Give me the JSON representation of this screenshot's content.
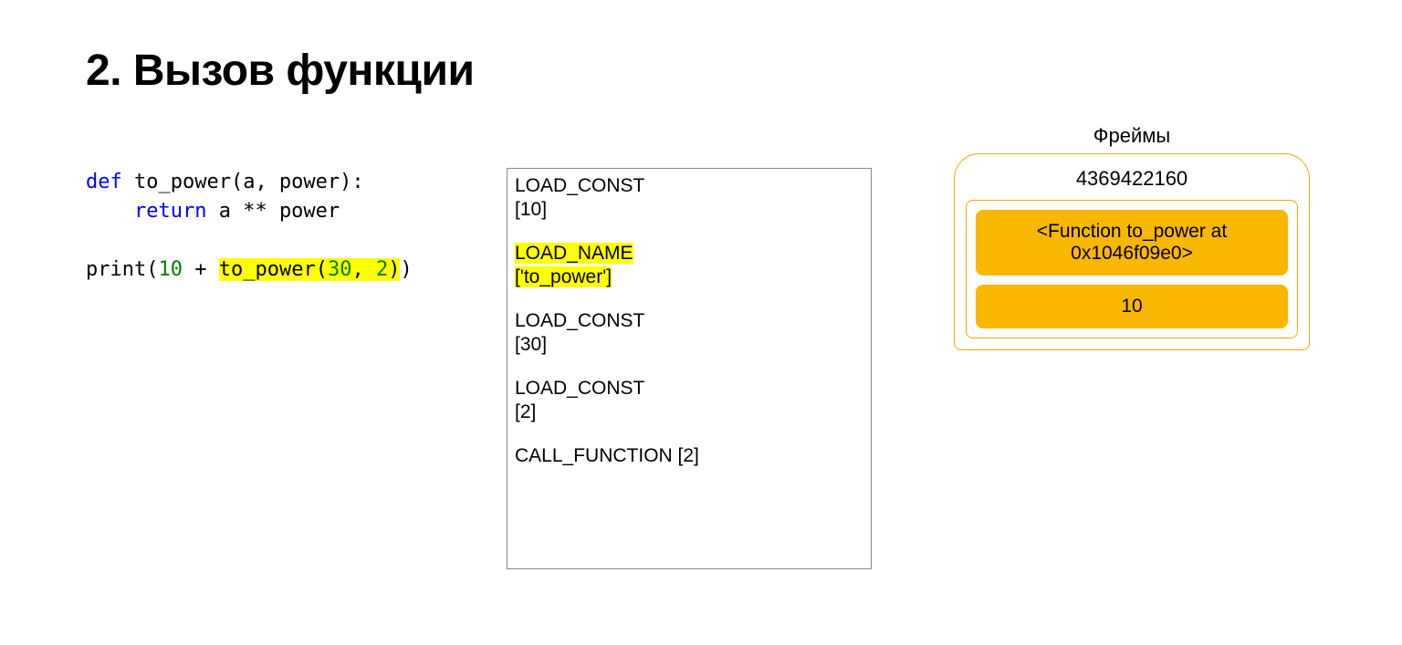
{
  "title": "2. Вызов функции",
  "code": {
    "line1": {
      "def": "def",
      "rest": " to_power(a, power):"
    },
    "line2": {
      "indent": "    ",
      "ret": "return",
      "mid": " a ** power"
    },
    "line3": {
      "pre": "print(",
      "num1": "10",
      "plus": " + ",
      "call_fn": "to_power(",
      "num2": "30",
      "comma": ", ",
      "num3": "2",
      "call_close": ")",
      "post": ")"
    }
  },
  "bytecode": [
    {
      "op": "LOAD_CONST",
      "arg": "[10]",
      "highlight": false
    },
    {
      "op": "LOAD_NAME",
      "arg": "['to_power']",
      "highlight": true
    },
    {
      "op": "LOAD_CONST",
      "arg": "[30]",
      "highlight": false
    },
    {
      "op": "LOAD_CONST",
      "arg": "[2]",
      "highlight": false
    },
    {
      "op": "CALL_FUNCTION [2]",
      "arg": "",
      "highlight": false
    }
  ],
  "frames": {
    "label": "Фреймы",
    "frame_id": "4369422160",
    "stack": [
      "<Function to_power at 0x1046f09e0>",
      "10"
    ]
  }
}
